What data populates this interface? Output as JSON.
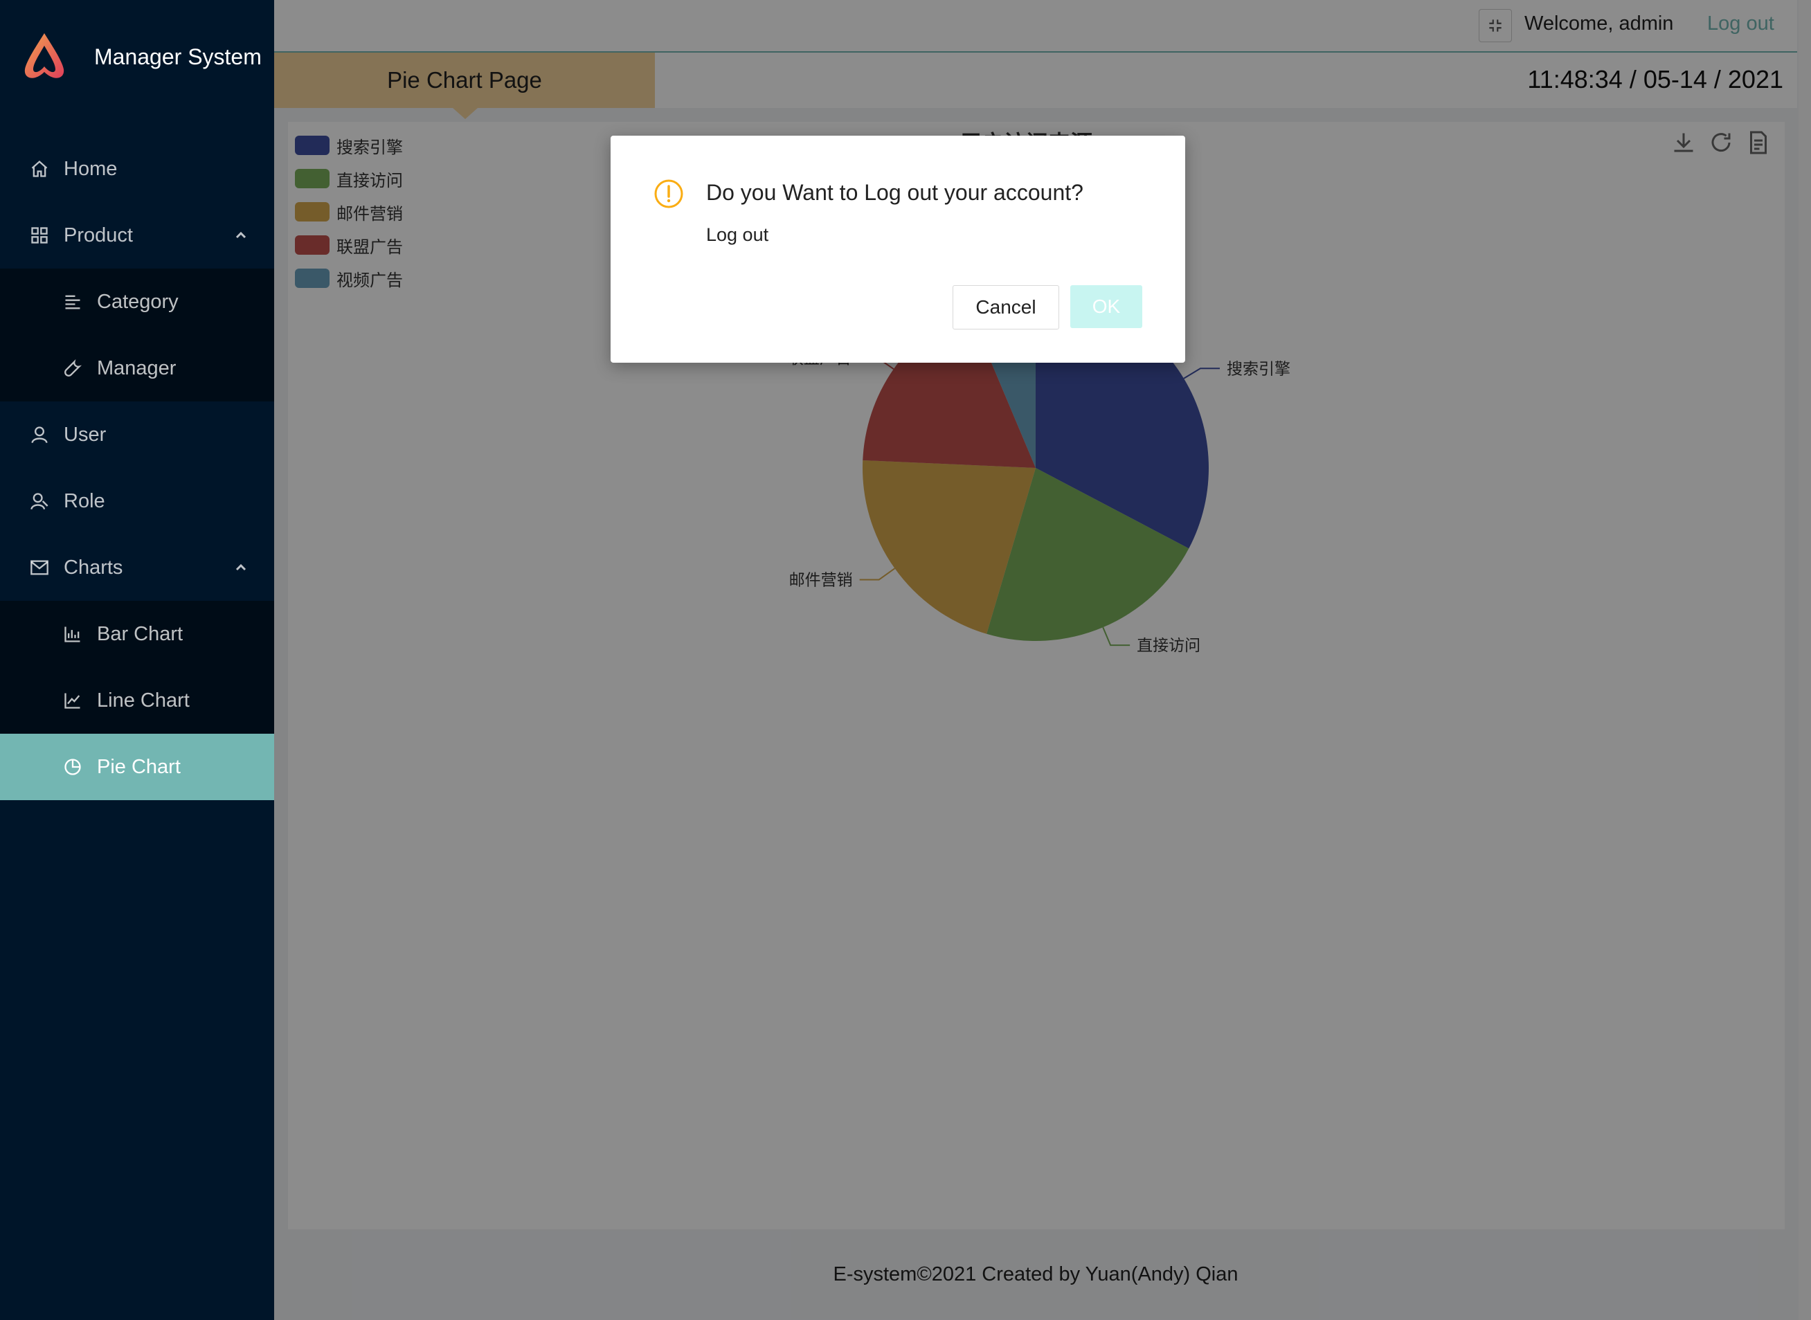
{
  "app": {
    "title": "Manager System"
  },
  "sidebar": {
    "items": [
      {
        "label": "Home",
        "icon": "home-icon"
      },
      {
        "label": "Product",
        "icon": "appstore-icon",
        "expanded": true
      },
      {
        "label": "Category",
        "icon": "bars-icon"
      },
      {
        "label": "Manager",
        "icon": "tool-icon"
      },
      {
        "label": "User",
        "icon": "user-icon"
      },
      {
        "label": "Role",
        "icon": "role-icon"
      },
      {
        "label": "Charts",
        "icon": "mail-icon",
        "expanded": true
      },
      {
        "label": "Bar Chart",
        "icon": "bar-chart-icon"
      },
      {
        "label": "Line Chart",
        "icon": "line-chart-icon"
      },
      {
        "label": "Pie Chart",
        "icon": "pie-chart-icon",
        "active": true
      }
    ]
  },
  "header": {
    "welcome": "Welcome, admin",
    "logout": "Log out"
  },
  "page": {
    "title": "Pie Chart Page",
    "datetime": "11:48:34 / 05-14 / 2021"
  },
  "chart_data": {
    "type": "pie",
    "title": "用户访问来源",
    "categories": [
      "搜索引擎",
      "直接访问",
      "邮件营销",
      "联盟广告",
      "视频广告"
    ],
    "values": [
      1548,
      1035,
      1000,
      850,
      300
    ],
    "colors": [
      "#3f4fa0",
      "#7ab05b",
      "#d6a84e",
      "#c0504d",
      "#6aa1bd"
    ],
    "legend": "top-left"
  },
  "footer": {
    "text": "E-system©2021 Created by Yuan(Andy) Qian"
  },
  "modal": {
    "title": "Do you Want to Log out your account?",
    "content": "Log out",
    "cancel": "Cancel",
    "ok": "OK"
  },
  "colors": {
    "accent": "#73b6b2",
    "sidebar": "#001529",
    "warning": "#faad14"
  }
}
